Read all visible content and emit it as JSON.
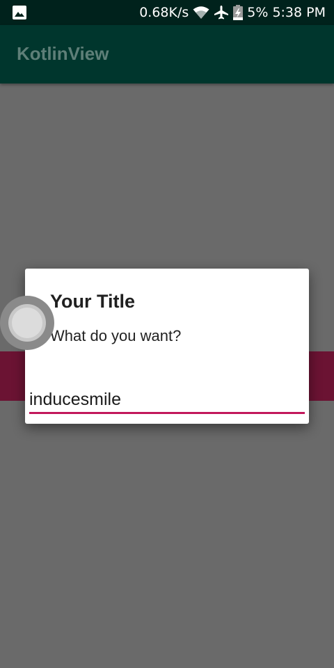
{
  "status_bar": {
    "network_speed": "0.68K/s",
    "battery_percent": "5%",
    "time": "5:38 PM",
    "icons": [
      "gallery-icon",
      "wifi-icon",
      "airplane-icon",
      "battery-charging-icon"
    ]
  },
  "app_bar": {
    "title": "KotlinView"
  },
  "dialog": {
    "title": "Your Title",
    "message": "What do you want?",
    "input_value": "inducesmile"
  },
  "colors": {
    "status_bar": "#00221c",
    "app_bar": "#00362d",
    "scrim": "#6a6a6a",
    "band": "#6b1333",
    "accent": "#c2185b"
  }
}
